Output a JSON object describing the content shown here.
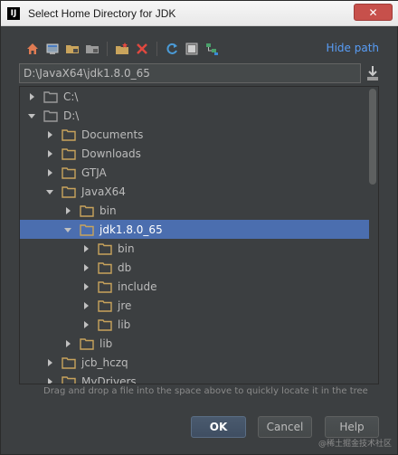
{
  "window": {
    "app_icon_text": "IJ",
    "title": "Select Home Directory for JDK",
    "close_label": "✕"
  },
  "toolbar": {
    "icons": [
      "home-icon",
      "desktop-icon",
      "project-folder-icon",
      "module-folder-icon",
      "new-folder-icon",
      "delete-icon",
      "refresh-icon",
      "show-hidden-icon",
      "tree-link-icon"
    ],
    "hide_path_label": "Hide path"
  },
  "path": {
    "value": "D:\\JavaX64\\jdk1.8.0_65"
  },
  "tree": {
    "rows": [
      {
        "label": "C:\\",
        "expanded": false
      },
      {
        "label": "D:\\",
        "expanded": true
      },
      {
        "label": "Documents",
        "expanded": false
      },
      {
        "label": "Downloads",
        "expanded": false
      },
      {
        "label": "GTJA",
        "expanded": false
      },
      {
        "label": "JavaX64",
        "expanded": true
      },
      {
        "label": "bin",
        "expanded": false
      },
      {
        "label": "jdk1.8.0_65",
        "expanded": true,
        "selected": true
      },
      {
        "label": "bin",
        "expanded": false
      },
      {
        "label": "db",
        "expanded": false
      },
      {
        "label": "include",
        "expanded": false
      },
      {
        "label": "jre",
        "expanded": false
      },
      {
        "label": "lib",
        "expanded": false
      },
      {
        "label": "lib",
        "expanded": false
      },
      {
        "label": "jcb_hczq",
        "expanded": false
      },
      {
        "label": "MyDrivers",
        "expanded": false
      }
    ]
  },
  "hint": "Drag and drop a file into the space above to quickly locate it in the tree",
  "buttons": {
    "ok": "OK",
    "cancel": "Cancel",
    "help": "Help"
  },
  "watermark": "@稀土掘金技术社区",
  "colors": {
    "background": "#3c3f41",
    "selection": "#4b6eaf",
    "link": "#589df6",
    "folder": "#c9a45c"
  }
}
